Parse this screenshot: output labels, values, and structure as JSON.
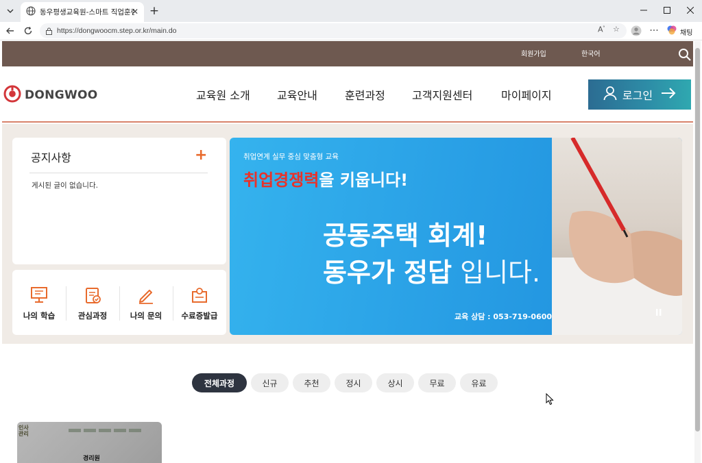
{
  "browser": {
    "tab_title": "동우평생교육원-스마트 직업훈련",
    "address": "https://dongwoocm.step.or.kr/main.do",
    "copilot_label": "채팅"
  },
  "site": {
    "topbar": {
      "join": "회원가입",
      "language": "한국어"
    },
    "logo_text": "DONGWOO",
    "nav": [
      "교육원 소개",
      "교육안내",
      "훈련과정",
      "고객지원센터",
      "마이페이지"
    ],
    "login_label": "로그인",
    "notice": {
      "title": "공지사항",
      "empty": "게시된 글이 없습니다."
    },
    "quick_menu": [
      "나의 학습",
      "관심과정",
      "나의 문의",
      "수료증발급"
    ],
    "banner": {
      "subtitle": "취업연계 실무 중심 맞춤형 교육",
      "headline_highlight": "취업경쟁력",
      "headline_rest": "을 키웁니다!",
      "big_line1": "공동주택 회계!",
      "big_line2_bold": "동우가 정답",
      "big_line2_light": " 입니다.",
      "contact": "교육 상담 : 053-719-0600",
      "pause_icon": "pause-icon"
    },
    "filters": [
      "전체과정",
      "신규",
      "추천",
      "정시",
      "상시",
      "무료",
      "유료"
    ],
    "course_card": {
      "badge": "인사 관리",
      "title": "경리원"
    }
  },
  "colors": {
    "topbar": "#6e5950",
    "accent_orange": "#e86a2c",
    "header_line": "#d8826a",
    "banner_blue": "#2aa1e6",
    "highlight_red": "#e8322a",
    "chip_active": "#2e3440"
  }
}
